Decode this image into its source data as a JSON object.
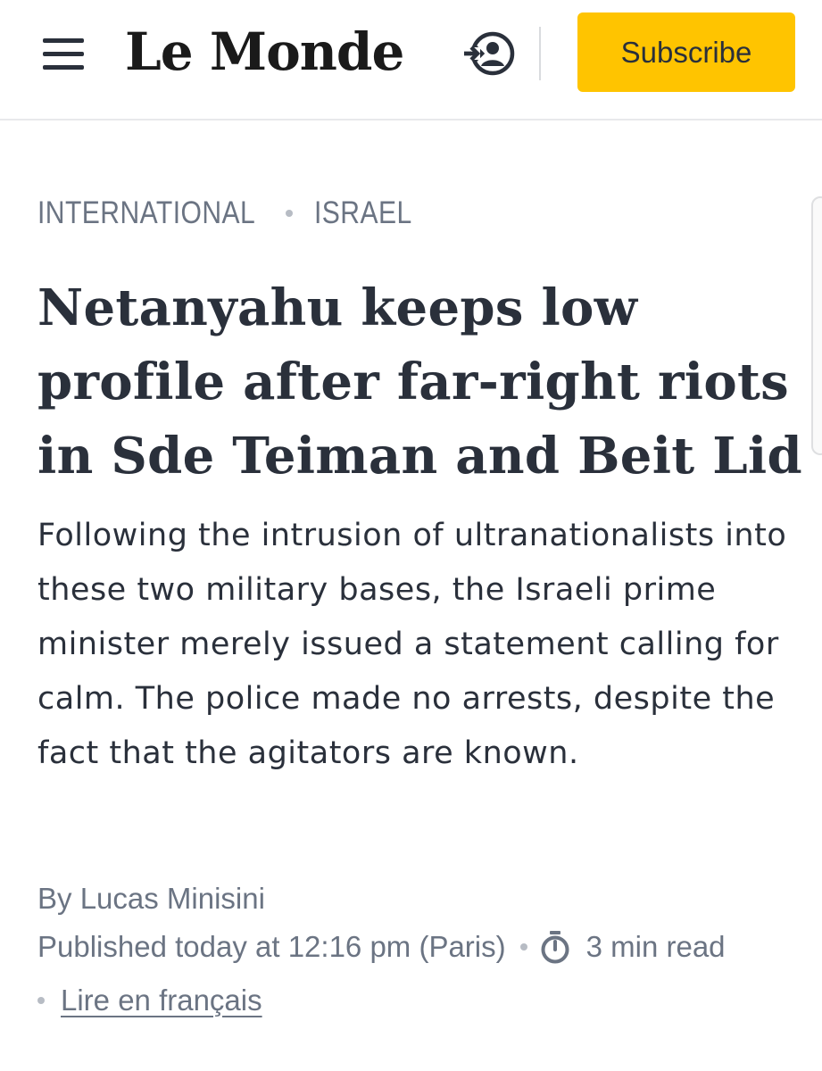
{
  "header": {
    "logo_text": "Le Monde",
    "menu_icon": "hamburger-menu-icon",
    "login_icon": "login-user-icon",
    "subscribe_label": "Subscribe",
    "accent_color": "#ffc400"
  },
  "article": {
    "breadcrumb": [
      "INTERNATIONAL",
      "ISRAEL"
    ],
    "headline": "Netanyahu keeps low profile after far-right riots in Sde Teiman and Beit Lid",
    "standfirst": "Following the intrusion of ultranationalists into these two military bases, the Israeli prime minister merely issued a statement calling for calm. The police made no arrests, despite the fact that the agitators are known.",
    "byline_prefix": "By",
    "author": "Lucas Minisini",
    "published": "Published today at 12:16 pm (Paris)",
    "read_time_icon": "timer-icon",
    "read_time": "3 min read",
    "french_link": "Lire en français"
  }
}
